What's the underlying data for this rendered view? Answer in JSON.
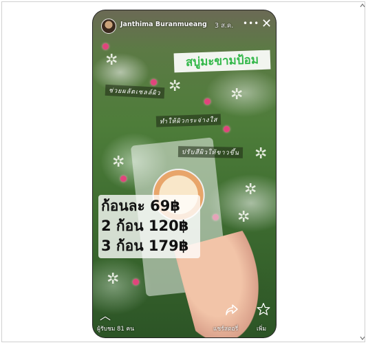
{
  "story": {
    "author": "Janthima Buranmueang",
    "date": "3 ส.ค.",
    "more_symbol": "•••",
    "close_symbol": "✕"
  },
  "stickers": {
    "title": "สบู่มะขามป้อม",
    "tag1": "ช่วยผลัดเซลล์ผิว",
    "tag2": "ทำให้ผิวกระจ่างใส",
    "tag3": "ปรับสีผิวให้ขาวขึ้น"
  },
  "prices": [
    "ก้อนละ 69฿",
    "2 ก้อน  120฿",
    "3 ก้อน  179฿"
  ],
  "footer": {
    "viewers": "ผู้รับชม 81 คน",
    "share_label": "แชร์สตอรี่",
    "more_label": "เพิ่ม"
  },
  "icons": {
    "collapse": "chevron-up-icon",
    "share": "share-arrow-icon",
    "star": "star-outline-icon"
  },
  "colors": {
    "title_text": "#33b84a",
    "accent_pink": "#e0457c"
  }
}
